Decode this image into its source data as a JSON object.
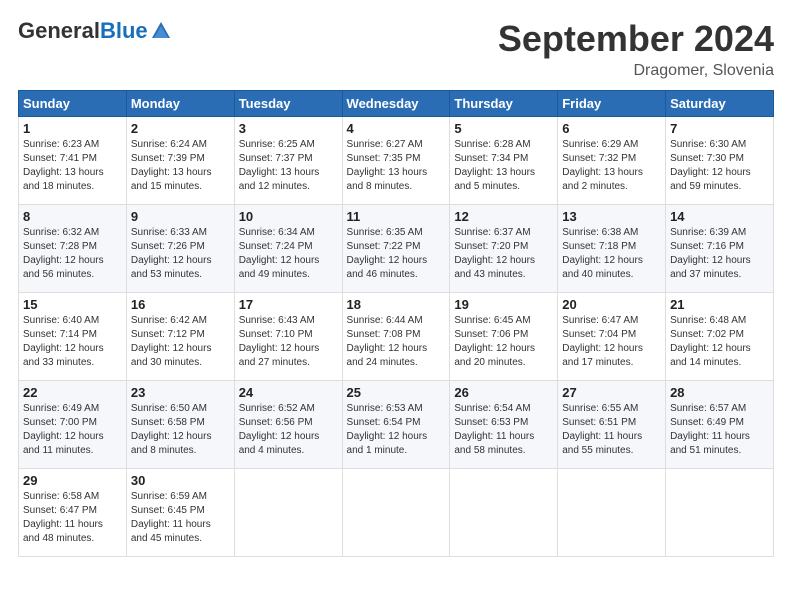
{
  "logo": {
    "general": "General",
    "blue": "Blue"
  },
  "header": {
    "month": "September 2024",
    "location": "Dragomer, Slovenia"
  },
  "days_of_week": [
    "Sunday",
    "Monday",
    "Tuesday",
    "Wednesday",
    "Thursday",
    "Friday",
    "Saturday"
  ],
  "weeks": [
    [
      {
        "day": "1",
        "info": "Sunrise: 6:23 AM\nSunset: 7:41 PM\nDaylight: 13 hours\nand 18 minutes."
      },
      {
        "day": "2",
        "info": "Sunrise: 6:24 AM\nSunset: 7:39 PM\nDaylight: 13 hours\nand 15 minutes."
      },
      {
        "day": "3",
        "info": "Sunrise: 6:25 AM\nSunset: 7:37 PM\nDaylight: 13 hours\nand 12 minutes."
      },
      {
        "day": "4",
        "info": "Sunrise: 6:27 AM\nSunset: 7:35 PM\nDaylight: 13 hours\nand 8 minutes."
      },
      {
        "day": "5",
        "info": "Sunrise: 6:28 AM\nSunset: 7:34 PM\nDaylight: 13 hours\nand 5 minutes."
      },
      {
        "day": "6",
        "info": "Sunrise: 6:29 AM\nSunset: 7:32 PM\nDaylight: 13 hours\nand 2 minutes."
      },
      {
        "day": "7",
        "info": "Sunrise: 6:30 AM\nSunset: 7:30 PM\nDaylight: 12 hours\nand 59 minutes."
      }
    ],
    [
      {
        "day": "8",
        "info": "Sunrise: 6:32 AM\nSunset: 7:28 PM\nDaylight: 12 hours\nand 56 minutes."
      },
      {
        "day": "9",
        "info": "Sunrise: 6:33 AM\nSunset: 7:26 PM\nDaylight: 12 hours\nand 53 minutes."
      },
      {
        "day": "10",
        "info": "Sunrise: 6:34 AM\nSunset: 7:24 PM\nDaylight: 12 hours\nand 49 minutes."
      },
      {
        "day": "11",
        "info": "Sunrise: 6:35 AM\nSunset: 7:22 PM\nDaylight: 12 hours\nand 46 minutes."
      },
      {
        "day": "12",
        "info": "Sunrise: 6:37 AM\nSunset: 7:20 PM\nDaylight: 12 hours\nand 43 minutes."
      },
      {
        "day": "13",
        "info": "Sunrise: 6:38 AM\nSunset: 7:18 PM\nDaylight: 12 hours\nand 40 minutes."
      },
      {
        "day": "14",
        "info": "Sunrise: 6:39 AM\nSunset: 7:16 PM\nDaylight: 12 hours\nand 37 minutes."
      }
    ],
    [
      {
        "day": "15",
        "info": "Sunrise: 6:40 AM\nSunset: 7:14 PM\nDaylight: 12 hours\nand 33 minutes."
      },
      {
        "day": "16",
        "info": "Sunrise: 6:42 AM\nSunset: 7:12 PM\nDaylight: 12 hours\nand 30 minutes."
      },
      {
        "day": "17",
        "info": "Sunrise: 6:43 AM\nSunset: 7:10 PM\nDaylight: 12 hours\nand 27 minutes."
      },
      {
        "day": "18",
        "info": "Sunrise: 6:44 AM\nSunset: 7:08 PM\nDaylight: 12 hours\nand 24 minutes."
      },
      {
        "day": "19",
        "info": "Sunrise: 6:45 AM\nSunset: 7:06 PM\nDaylight: 12 hours\nand 20 minutes."
      },
      {
        "day": "20",
        "info": "Sunrise: 6:47 AM\nSunset: 7:04 PM\nDaylight: 12 hours\nand 17 minutes."
      },
      {
        "day": "21",
        "info": "Sunrise: 6:48 AM\nSunset: 7:02 PM\nDaylight: 12 hours\nand 14 minutes."
      }
    ],
    [
      {
        "day": "22",
        "info": "Sunrise: 6:49 AM\nSunset: 7:00 PM\nDaylight: 12 hours\nand 11 minutes."
      },
      {
        "day": "23",
        "info": "Sunrise: 6:50 AM\nSunset: 6:58 PM\nDaylight: 12 hours\nand 8 minutes."
      },
      {
        "day": "24",
        "info": "Sunrise: 6:52 AM\nSunset: 6:56 PM\nDaylight: 12 hours\nand 4 minutes."
      },
      {
        "day": "25",
        "info": "Sunrise: 6:53 AM\nSunset: 6:54 PM\nDaylight: 12 hours\nand 1 minute."
      },
      {
        "day": "26",
        "info": "Sunrise: 6:54 AM\nSunset: 6:53 PM\nDaylight: 11 hours\nand 58 minutes."
      },
      {
        "day": "27",
        "info": "Sunrise: 6:55 AM\nSunset: 6:51 PM\nDaylight: 11 hours\nand 55 minutes."
      },
      {
        "day": "28",
        "info": "Sunrise: 6:57 AM\nSunset: 6:49 PM\nDaylight: 11 hours\nand 51 minutes."
      }
    ],
    [
      {
        "day": "29",
        "info": "Sunrise: 6:58 AM\nSunset: 6:47 PM\nDaylight: 11 hours\nand 48 minutes."
      },
      {
        "day": "30",
        "info": "Sunrise: 6:59 AM\nSunset: 6:45 PM\nDaylight: 11 hours\nand 45 minutes."
      },
      {
        "day": "",
        "info": ""
      },
      {
        "day": "",
        "info": ""
      },
      {
        "day": "",
        "info": ""
      },
      {
        "day": "",
        "info": ""
      },
      {
        "day": "",
        "info": ""
      }
    ]
  ]
}
